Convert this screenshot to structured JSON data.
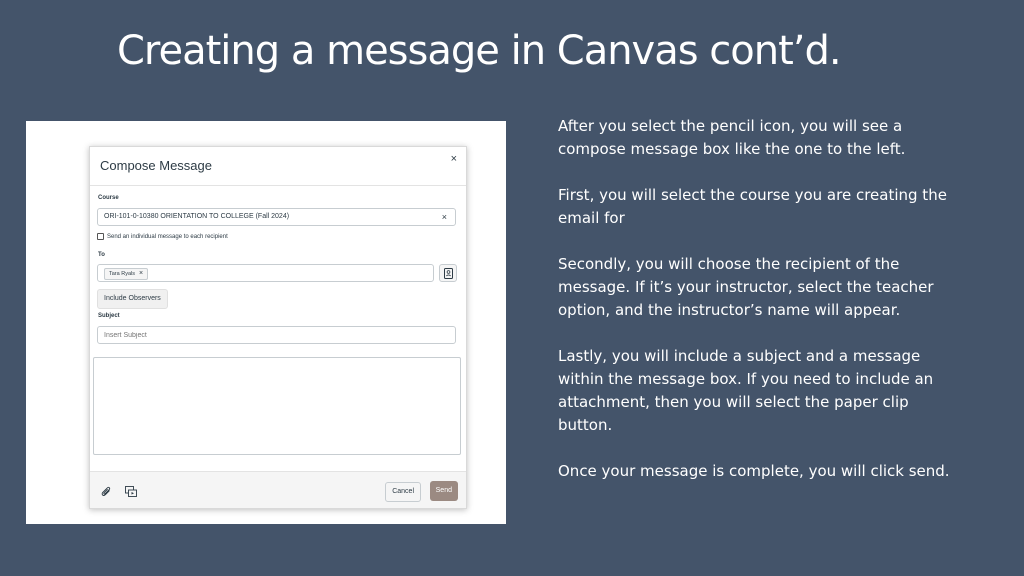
{
  "slide": {
    "title": "Creating a message in Canvas cont’d."
  },
  "compose": {
    "title": "Compose Message",
    "close_label": "×",
    "course_label": "Course",
    "course_value": "ORI-101-0-10380 ORIENTATION TO COLLEGE (Fall 2024)",
    "course_clear": "×",
    "individual_checkbox_label": "Send an individual message to each recipient",
    "to_label": "To",
    "recipient_name": "Tara Ryals",
    "recipient_remove": "×",
    "include_observers_label": "Include Observers",
    "subject_label": "Subject",
    "subject_placeholder": "Insert Subject",
    "cancel_label": "Cancel",
    "send_label": "Send",
    "icons": [
      "close-icon",
      "clear-icon",
      "address-book-icon",
      "paperclip-icon",
      "media-icon"
    ]
  },
  "instructions": {
    "paragraphs": [
      "After you select the pencil icon, you will see a compose message box like the one to the left.",
      "First, you will select the course you are creating the email for",
      "Secondly, you will choose the recipient of the message. If it’s your instructor, select the teacher option, and the instructor’s name will appear.",
      "Lastly, you will include a subject and a message within the message box. If you need to include an attachment, then you will select the paper clip button.",
      "Once your message is complete, you will click send."
    ]
  },
  "colors": {
    "background": "#44546a",
    "send_button": "#9b8a82",
    "text": "#ffffff"
  }
}
